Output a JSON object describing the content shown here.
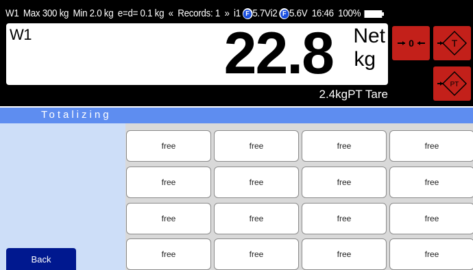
{
  "status": {
    "scale": "W1",
    "max": "Max 300 kg",
    "min": "Min 2.0 kg",
    "division": "e=d= 0.1 kg",
    "records_prev": "«",
    "records": "Records: 1",
    "records_next": "»",
    "input1_label": "i1",
    "input1_voltage": "5.7V",
    "input2_label": "i2",
    "input2_voltage": "5.6V",
    "f_glyph": "F",
    "time": "16:46",
    "battery": "100%"
  },
  "display": {
    "scale_name": "W1",
    "weight": "22.8",
    "mode": "Net",
    "unit": "kg",
    "tare": "2.4kgPT Tare"
  },
  "buttons": {
    "zero_label": "0",
    "tare_label": "T",
    "preset_tare_label": "PT",
    "accent": "#c3201a"
  },
  "section": {
    "title": "Totalizing"
  },
  "slots": [
    [
      "free",
      "free",
      "free",
      "free"
    ],
    [
      "free",
      "free",
      "free",
      "free"
    ],
    [
      "free",
      "free",
      "free",
      "free"
    ],
    [
      "free",
      "free",
      "free",
      "free"
    ]
  ],
  "back_label": "Back",
  "colors": {
    "section_bar": "#5e8df0",
    "left_panel": "#cddef8",
    "back_button": "#00188f"
  }
}
